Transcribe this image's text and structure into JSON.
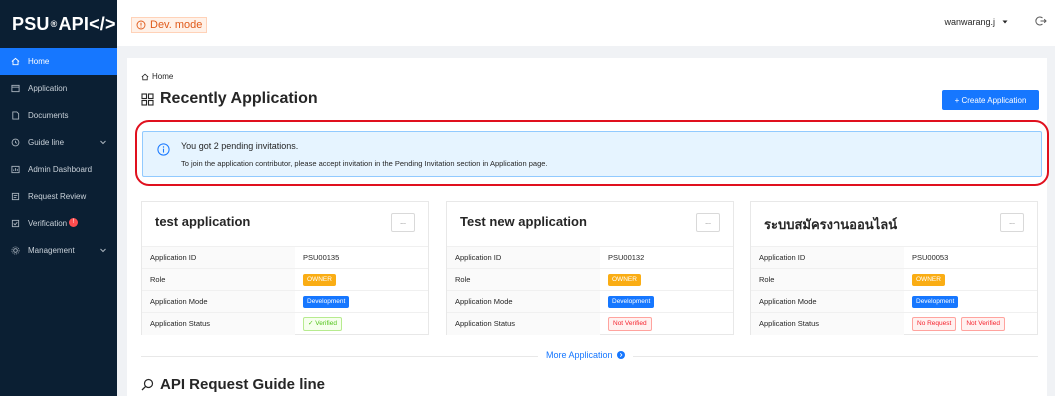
{
  "brand": {
    "logo_part1": "PSU",
    "logo_reg": "®",
    "logo_part2": "API</>"
  },
  "sidebar": {
    "items": [
      {
        "label": "Home",
        "icon": "home-icon",
        "active": true
      },
      {
        "label": "Application",
        "icon": "app-icon"
      },
      {
        "label": "Documents",
        "icon": "document-icon"
      },
      {
        "label": "Guide line",
        "icon": "guide-icon",
        "expandable": true
      },
      {
        "label": "Admin Dashboard",
        "icon": "dashboard-icon"
      },
      {
        "label": "Request Review",
        "icon": "review-icon"
      },
      {
        "label": "Verification",
        "icon": "verification-icon",
        "badge": "!"
      },
      {
        "label": "Management",
        "icon": "management-icon",
        "expandable": true
      }
    ]
  },
  "topbar": {
    "mode_label": "Dev. mode",
    "username": "wanwarang.j"
  },
  "breadcrumb": {
    "home": "Home"
  },
  "page": {
    "title": "Recently Application",
    "create_button": "+ Create Application"
  },
  "invitation": {
    "title": "You got 2 pending invitations.",
    "description": "To join the application contributor, please accept invitation in the Pending Invitation section in Application page."
  },
  "labels": {
    "app_id": "Application ID",
    "role": "Role",
    "mode": "Application Mode",
    "status": "Application Status",
    "more_button": "..."
  },
  "apps": [
    {
      "name": "test application",
      "id": "PSU00135",
      "role": "OWNER",
      "mode": "Development",
      "status": [
        "✓ Verified"
      ]
    },
    {
      "name": "Test new application",
      "id": "PSU00132",
      "role": "OWNER",
      "mode": "Development",
      "status": [
        "Not Verified"
      ]
    },
    {
      "name": "ระบบสมัครงานออนไลน์",
      "id": "PSU00053",
      "role": "OWNER",
      "mode": "Development",
      "status": [
        "No Request",
        "Not Verified"
      ]
    }
  ],
  "more_apps": "More Application",
  "guide": {
    "title": "API Request Guide line"
  },
  "colors": {
    "sidebar_bg": "#0b1f33",
    "primary": "#1677ff",
    "alert_border": "#e0101e"
  }
}
